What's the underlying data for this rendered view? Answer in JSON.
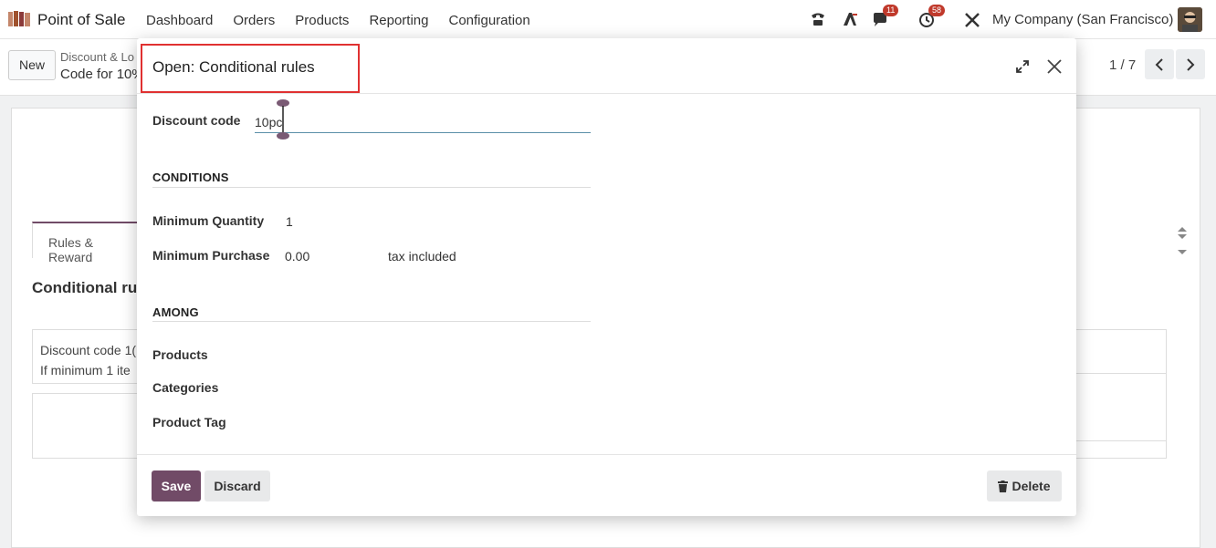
{
  "navbar": {
    "app_name": "Point of Sale",
    "menu": [
      "Dashboard",
      "Orders",
      "Products",
      "Reporting",
      "Configuration"
    ],
    "messages_count": "11",
    "activities_count": "58",
    "company": "My Company (San Francisco)"
  },
  "control_panel": {
    "new_label": "New",
    "breadcrumb_parent": "Discount & Lo",
    "breadcrumb_current": "Code for 10%",
    "pager": "1 / 7"
  },
  "background": {
    "tab_label": "Rules & Reward",
    "section_title": "Conditional ru",
    "card_line1": "Discount code 1(",
    "card_line2": "If minimum 1 ite"
  },
  "modal": {
    "title": "Open: Conditional rules",
    "discount_code_label": "Discount code",
    "discount_code_value": "10pc",
    "conditions_title": "CONDITIONS",
    "min_qty_label": "Minimum Quantity",
    "min_qty_value": "1",
    "min_purchase_label": "Minimum Purchase",
    "min_purchase_value": "0.00",
    "tax_mode": "tax included",
    "among_title": "AMONG",
    "products_label": "Products",
    "categories_label": "Categories",
    "product_tag_label": "Product Tag",
    "save_label": "Save",
    "discard_label": "Discard",
    "delete_label": "Delete"
  },
  "colors": {
    "brand": "#714b67",
    "highlight": "#e03131",
    "badge": "#c0392b"
  }
}
